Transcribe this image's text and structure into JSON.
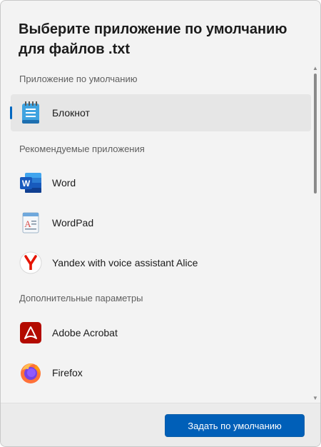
{
  "dialog": {
    "title": "Выберите приложение по умолчанию для файлов .txt"
  },
  "sections": {
    "default": "Приложение по умолчанию",
    "recommended": "Рекомендуемые приложения",
    "more": "Дополнительные параметры"
  },
  "apps": {
    "notepad": {
      "label": "Блокнот",
      "icon": "notepad-icon"
    },
    "word": {
      "label": "Word",
      "icon": "word-icon"
    },
    "wordpad": {
      "label": "WordPad",
      "icon": "wordpad-icon"
    },
    "yandex": {
      "label": "Yandex with voice assistant Alice",
      "icon": "yandex-icon"
    },
    "acrobat": {
      "label": "Adobe Acrobat",
      "icon": "acrobat-icon"
    },
    "firefox": {
      "label": "Firefox",
      "icon": "firefox-icon"
    }
  },
  "footer": {
    "set_default_label": "Задать по умолчанию"
  },
  "colors": {
    "accent": "#005fb8",
    "selection_bar": "#0067c0",
    "background": "#f3f3f3"
  }
}
